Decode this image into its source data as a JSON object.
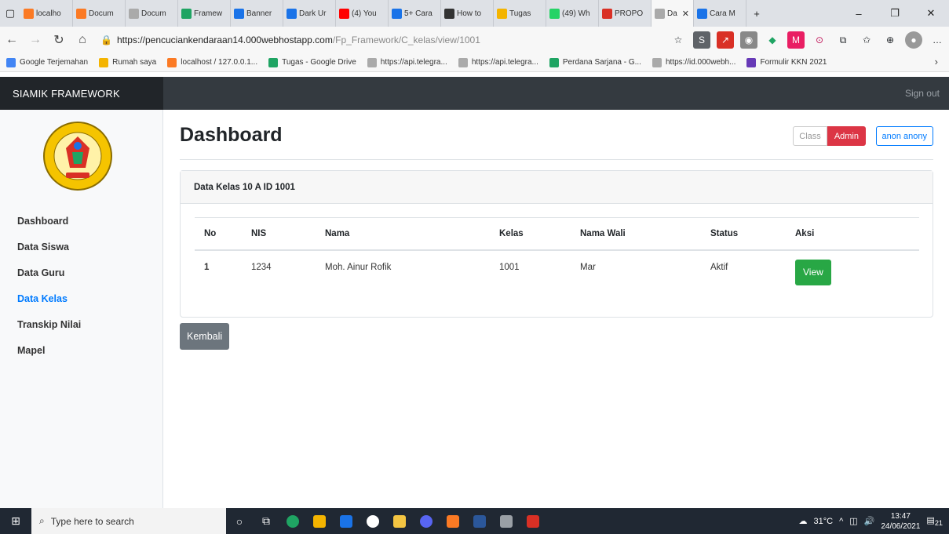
{
  "browser": {
    "tabs": [
      {
        "label": "localho",
        "color": "#fb7a24"
      },
      {
        "label": "Docum",
        "color": "#fb7a24"
      },
      {
        "label": "Docum",
        "color": "#aaaaaa"
      },
      {
        "label": "Framew",
        "color": "#1fa463"
      },
      {
        "label": "Banner",
        "color": "#1a73e8"
      },
      {
        "label": "Dark Ur",
        "color": "#1a73e8"
      },
      {
        "label": "(4) You",
        "color": "#ff0000"
      },
      {
        "label": "5+ Cara",
        "color": "#1a73e8"
      },
      {
        "label": "How to",
        "color": "#333333"
      },
      {
        "label": "Tugas",
        "color": "#f4b400"
      },
      {
        "label": "(49) Wh",
        "color": "#25d366"
      },
      {
        "label": "PROPO",
        "color": "#d93025"
      },
      {
        "label": "Da",
        "color": "#aaaaaa",
        "active": true
      },
      {
        "label": "Cara M",
        "color": "#1a73e8"
      }
    ],
    "new_tab": "+",
    "url_host": "https://pencuciankendaraan14.000webhostapp.com",
    "url_path": "/Fp_Framework/C_kelas/view/1001",
    "bookmarks": [
      {
        "label": "Google Terjemahan",
        "color": "#4285f4"
      },
      {
        "label": "Rumah saya",
        "color": "#f4b400"
      },
      {
        "label": "localhost / 127.0.0.1...",
        "color": "#fb7a24"
      },
      {
        "label": "Tugas - Google Drive",
        "color": "#1fa463"
      },
      {
        "label": "https://api.telegra...",
        "color": "#aaaaaa"
      },
      {
        "label": "https://api.telegra...",
        "color": "#aaaaaa"
      },
      {
        "label": "Perdana Sarjana - G...",
        "color": "#1fa463"
      },
      {
        "label": "https://id.000webh...",
        "color": "#aaaaaa"
      },
      {
        "label": "Formulir KKN 2021",
        "color": "#673ab7"
      }
    ]
  },
  "app": {
    "brand": "SIAMIK FRAMEWORK",
    "signout": "Sign out",
    "menu": [
      {
        "label": "Dashboard",
        "active": false
      },
      {
        "label": "Data Siswa",
        "active": false
      },
      {
        "label": "Data Guru",
        "active": false
      },
      {
        "label": "Data Kelas",
        "active": true
      },
      {
        "label": "Transkip Nilai",
        "active": false
      },
      {
        "label": "Mapel",
        "active": false
      }
    ],
    "page_title": "Dashboard",
    "role_class": "Class",
    "role_admin": "Admin",
    "user": "anon anony",
    "card_title": "Data Kelas 10 A ID 1001",
    "table": {
      "headers": [
        "No",
        "NIS",
        "Nama",
        "Kelas",
        "Nama Wali",
        "Status",
        "Aksi"
      ],
      "rows": [
        {
          "no": "1",
          "nis": "1234",
          "nama": "Moh. Ainur Rofik",
          "kelas": "1001",
          "wali": "Mar",
          "status": "Aktif",
          "aksi": "View"
        }
      ]
    },
    "back_button": "Kembali",
    "colors": {
      "admin": "#dc3545",
      "view": "#28a745",
      "active_link": "#007bff"
    }
  },
  "taskbar": {
    "search_placeholder": "Type here to search",
    "weather": "31°C",
    "time": "13:47",
    "date": "24/06/2021",
    "notifications": "21"
  }
}
